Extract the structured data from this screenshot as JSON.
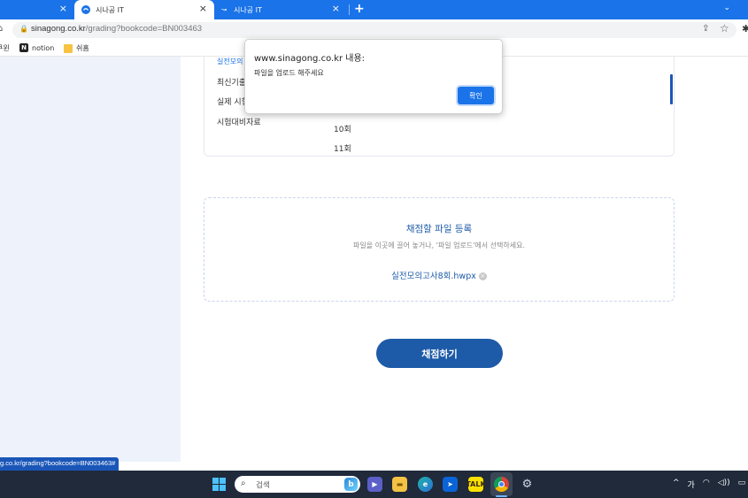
{
  "browser": {
    "tabs": [
      {
        "label": "",
        "close": "×"
      },
      {
        "label": "시나공 IT",
        "close": "×",
        "active": true
      },
      {
        "label": "시나공 IT",
        "close": "×"
      }
    ],
    "new_tab": "+",
    "tab_menu": "⌄",
    "url_host": "sinagong.co.kr",
    "url_path": "/grading?bookcode=BN003463"
  },
  "bookmarks": [
    {
      "label": "쿠윈",
      "icon": "bookmark-icon"
    },
    {
      "label": "notion",
      "icon": "notion-icon"
    },
    {
      "label": "쉬홈",
      "icon": "folder-icon"
    }
  ],
  "content": {
    "categories": [
      "실전모의",
      "최신기출",
      "실제 시험",
      "시험대비자료"
    ],
    "subitems": [
      "10회",
      "11회"
    ],
    "upload": {
      "title": "채점할 파일 등록",
      "description": "파일을 이곳에 끌어 놓거나, '파일 업로드'에서 선택하세요.",
      "file_name": "실전모의고사8회.hwpx",
      "remove_symbol": "×"
    },
    "grade_button": "채점하기"
  },
  "status_bar": {
    "url": "g.co.kr/grading?bookcode=BN003463#"
  },
  "dialog": {
    "title": "www.sinagong.co.kr 내용:",
    "message": "파일을 업로드 해주세요",
    "ok_label": "확인"
  },
  "taskbar": {
    "search_label": "검색",
    "tray": {
      "chevron": "^",
      "ime": "가",
      "wifi": "wifi-icon",
      "volume": "volume-icon",
      "battery": "battery-icon"
    }
  },
  "colors": {
    "tab_strip": "#1a73e8",
    "accent": "#1d5aa8",
    "left_panel": "#eef3fb",
    "taskbar": "#202a3a"
  }
}
